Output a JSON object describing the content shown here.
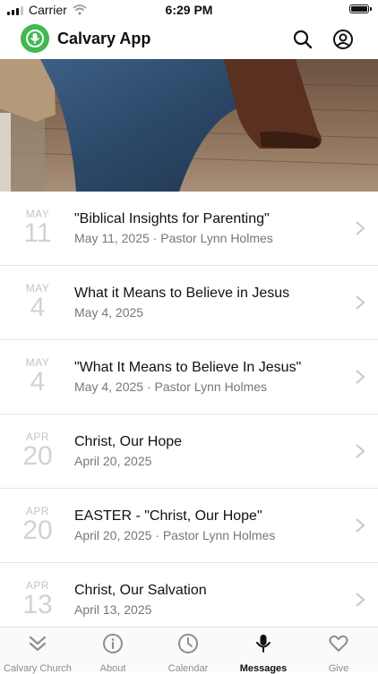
{
  "status_bar": {
    "carrier": "Carrier",
    "time": "6:29 PM"
  },
  "header": {
    "title": "Calvary App"
  },
  "messages": [
    {
      "month": "MAY",
      "day": "11",
      "title": "\"Biblical Insights for Parenting\"",
      "subtitle": "May 11, 2025 · Pastor Lynn Holmes"
    },
    {
      "month": "MAY",
      "day": "4",
      "title": "What it Means to Believe in Jesus",
      "subtitle": "May 4, 2025"
    },
    {
      "month": "MAY",
      "day": "4",
      "title": "\"What It Means to Believe In Jesus\"",
      "subtitle": "May 4, 2025 · Pastor Lynn Holmes"
    },
    {
      "month": "APR",
      "day": "20",
      "title": "Christ, Our Hope",
      "subtitle": "April 20, 2025"
    },
    {
      "month": "APR",
      "day": "20",
      "title": "EASTER - \"Christ, Our Hope\"",
      "subtitle": "April 20, 2025 · Pastor Lynn Holmes"
    },
    {
      "month": "APR",
      "day": "13",
      "title": "Christ, Our Salvation",
      "subtitle": "April 13, 2025"
    }
  ],
  "tabs": [
    {
      "label": "Calvary Church",
      "icon": "chevrons-down-icon",
      "active": false
    },
    {
      "label": "About",
      "icon": "info-icon",
      "active": false
    },
    {
      "label": "Calendar",
      "icon": "clock-icon",
      "active": false
    },
    {
      "label": "Messages",
      "icon": "microphone-icon",
      "active": true
    },
    {
      "label": "Give",
      "icon": "heart-icon",
      "active": false
    }
  ],
  "colors": {
    "brand_green": "#3fb950",
    "active_tab": "#111111",
    "inactive_tab": "#8e8e93"
  }
}
